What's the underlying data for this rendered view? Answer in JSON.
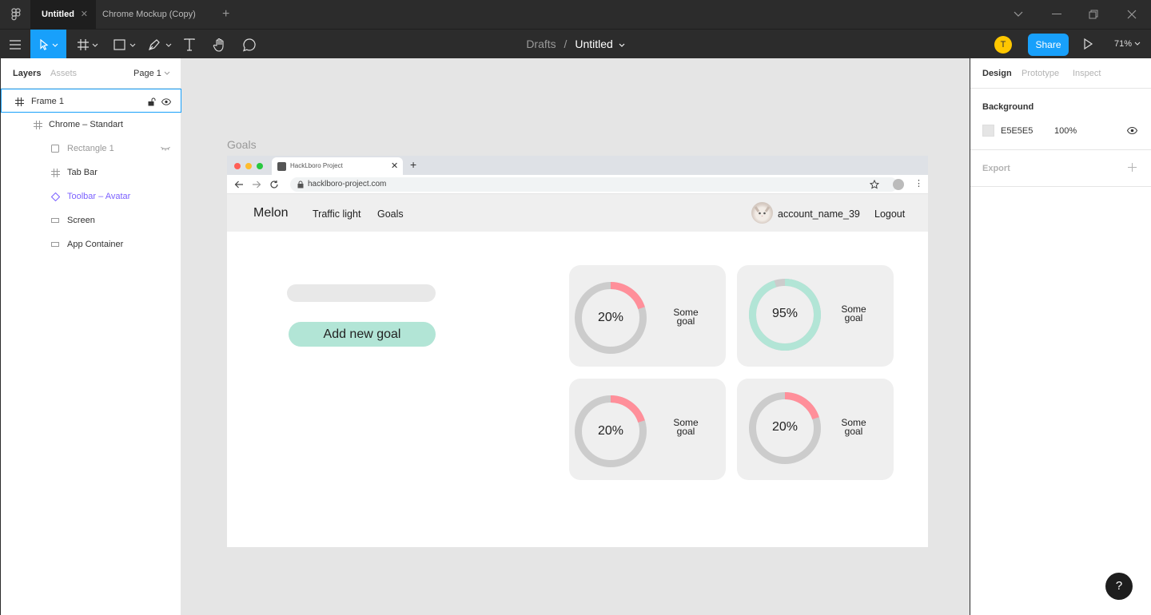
{
  "titlebar": {
    "tabs": [
      {
        "label": "Untitled",
        "active": true
      },
      {
        "label": "Chrome Mockup (Copy)",
        "active": false
      }
    ]
  },
  "toolbar": {
    "breadcrumb_parent": "Drafts",
    "breadcrumb_sep": "/",
    "file_name": "Untitled",
    "user_initial": "T",
    "share_label": "Share",
    "zoom": "71%"
  },
  "left_panel": {
    "tabs": [
      "Layers",
      "Assets"
    ],
    "page": "Page 1",
    "layers": [
      {
        "name": "Frame 1"
      },
      {
        "name": "Chrome – Standart"
      },
      {
        "name": "Rectangle 1"
      },
      {
        "name": "Tab Bar"
      },
      {
        "name": "Toolbar – Avatar"
      },
      {
        "name": "Screen"
      },
      {
        "name": "App Container"
      }
    ]
  },
  "right_panel": {
    "tabs": [
      "Design",
      "Prototype",
      "Inspect"
    ],
    "background_title": "Background",
    "background_hex": "E5E5E5",
    "background_opacity": "100%",
    "export_title": "Export"
  },
  "canvas": {
    "frame_label": "Goals",
    "browser": {
      "tab_title": "HackLboro Project",
      "url": "hacklboro-project.com"
    },
    "app": {
      "brand": "Melon",
      "nav": [
        "Traffic light",
        "Goals"
      ],
      "username": "account_name_39",
      "logout": "Logout",
      "add_goal_label": "Add new goal",
      "goals": [
        {
          "percent_label": "20%",
          "progress": 0.2,
          "name_line1": "Some",
          "name_line2": "goal",
          "color": "#ff8f9a"
        },
        {
          "percent_label": "95%",
          "progress": 0.95,
          "name_line1": "Some",
          "name_line2": "goal",
          "color": "#b2e5d6"
        },
        {
          "percent_label": "20%",
          "progress": 0.2,
          "name_line1": "Some",
          "name_line2": "goal",
          "color": "#ff8f9a"
        },
        {
          "percent_label": "20%",
          "progress": 0.2,
          "name_line1": "Some",
          "name_line2": "goal",
          "color": "#ff8f9a"
        }
      ]
    }
  },
  "colors": {
    "accent": "#18a0fb",
    "canvas_bg": "#e5e5e5",
    "mint": "#b2e5d6",
    "pink": "#ff8f9a",
    "track": "#cccccc"
  },
  "help": "?"
}
